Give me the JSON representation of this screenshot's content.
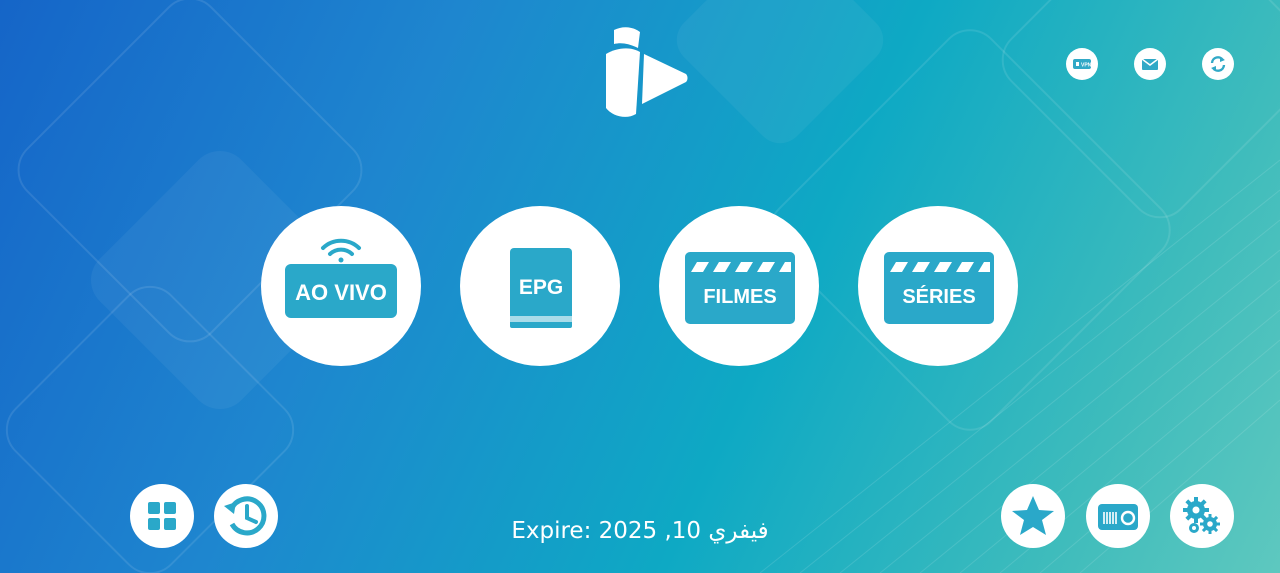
{
  "header": {
    "vpn_icon_label": "VPN"
  },
  "menu": {
    "live_tv_label": "AO VIVO",
    "epg_label": "EPG",
    "movies_label": "FILMES",
    "series_label": "SÉRIES"
  },
  "footer": {
    "expire_text": "Expire: 2025 ,10 فيفري"
  },
  "colors": {
    "accent": "#2aa8c9",
    "icon_fg": "#31a9c7",
    "tile_bg": "#ffffff"
  },
  "icons": [
    "logo",
    "vpn-icon",
    "mail-icon",
    "refresh-icon",
    "wifi-icon",
    "book-icon",
    "clapper-icon",
    "grid-icon",
    "history-icon",
    "star-icon",
    "radio-icon",
    "settings-icon"
  ]
}
